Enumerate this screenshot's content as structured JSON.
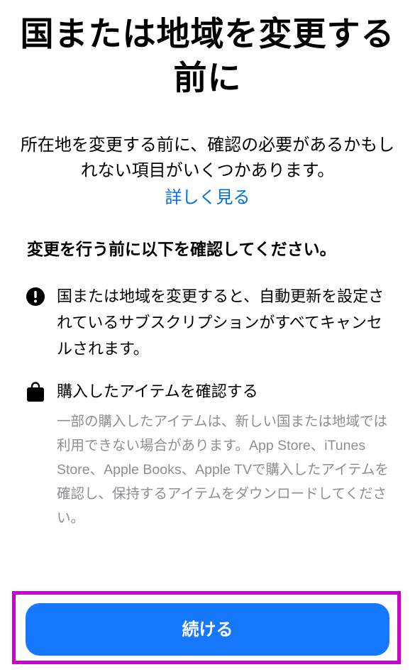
{
  "title": "国または地域を変更する前に",
  "intro": "所在地を変更する前に、確認の必要があるかもしれない項目がいくつかあります。",
  "learn_more": "詳しく見る",
  "section_heading": "変更を行う前に以下を確認してください。",
  "items": [
    {
      "icon": "exclamation-circle-icon",
      "text": "国または地域を変更すると、自動更新を設定されているサブスクリプションがすべてキャンセルされます。"
    },
    {
      "icon": "shopping-bag-icon",
      "title": "購入したアイテムを確認する",
      "description": "一部の購入したアイテムは、新しい国または地域では利用できない場合があります。App Store、iTunes Store、Apple Books、Apple TVで購入したアイテムを確認し、保持するアイテムをダウンロードしてください。"
    }
  ],
  "continue_button": "続ける",
  "colors": {
    "link": "#0071e3",
    "button": "#1677ff",
    "secondary_text": "#8e8e93",
    "highlight": "#cc00cc"
  }
}
